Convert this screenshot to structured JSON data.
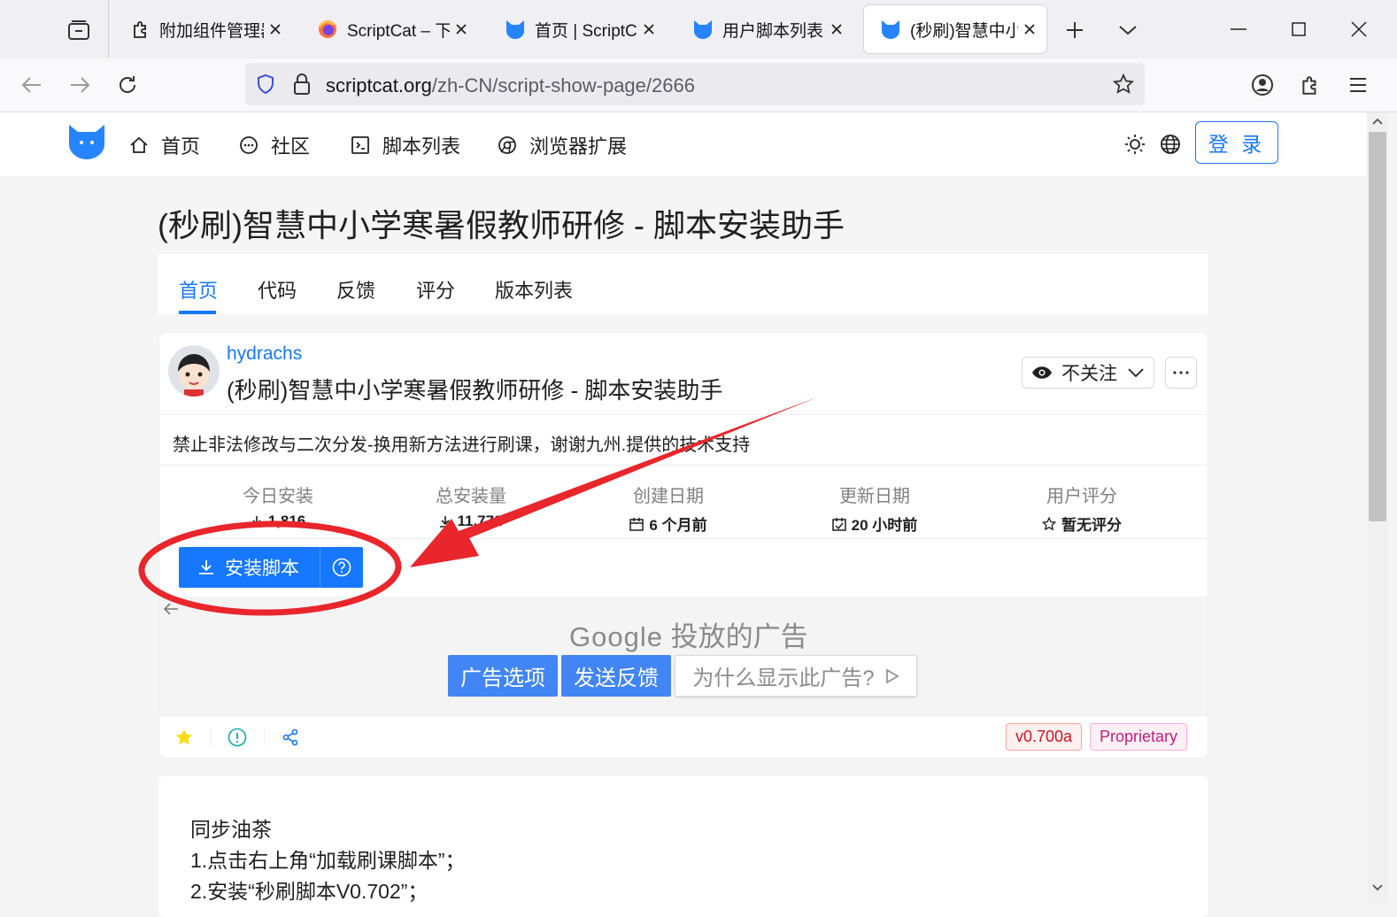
{
  "browser": {
    "tabs": [
      {
        "title": "附加组件管理器",
        "icon": "puzzle-icon"
      },
      {
        "title": "ScriptCat – 下载",
        "icon": "firefox-icon"
      },
      {
        "title": "首页 | ScriptCat",
        "icon": "scriptcat-icon"
      },
      {
        "title": "用户脚本列表 -",
        "icon": "scriptcat-icon"
      },
      {
        "title": "(秒刷)智慧中小学",
        "icon": "scriptcat-icon",
        "active": true
      }
    ],
    "url_host": "scriptcat.org",
    "url_path": "/zh-CN/script-show-page/2666"
  },
  "site": {
    "nav": [
      {
        "label": "首页",
        "icon": "home-icon"
      },
      {
        "label": "社区",
        "icon": "chat-icon"
      },
      {
        "label": "脚本列表",
        "icon": "terminal-icon"
      },
      {
        "label": "浏览器扩展",
        "icon": "chrome-icon"
      }
    ],
    "login_label": "登 录"
  },
  "page": {
    "title": "(秒刷)智慧中小学寒暑假教师研修 - 脚本安装助手",
    "tabs": [
      "首页",
      "代码",
      "反馈",
      "评分",
      "版本列表"
    ],
    "active_tab": 0
  },
  "script": {
    "author": "hydrachs",
    "name": "(秒刷)智慧中小学寒暑假教师研修 - 脚本安装助手",
    "watch_label": "不关注",
    "description": "禁止非法修改与二次分发-换用新方法进行刷课，谢谢九州.提供的技术支持",
    "stats": [
      {
        "label": "今日安装",
        "value": "1,816",
        "icon": "download-icon"
      },
      {
        "label": "总安装量",
        "value": "11,772",
        "icon": "download-icon"
      },
      {
        "label": "创建日期",
        "value": "6 个月前",
        "icon": "calendar-icon"
      },
      {
        "label": "更新日期",
        "value": "20 小时前",
        "icon": "calendar-check-icon"
      },
      {
        "label": "用户评分",
        "value": "暂无评分",
        "icon": "star-outline-icon"
      }
    ],
    "install_label": "安装脚本",
    "version_tag": "v0.700a",
    "license_tag": "Proprietary"
  },
  "ad": {
    "brand": "Google",
    "brand_suffix": "投放的广告",
    "options_label": "广告选项",
    "feedback_label": "发送反馈",
    "why_label": "为什么显示此广告?"
  },
  "content": {
    "lines": [
      "同步油茶",
      "1.点击右上角“加载刷课脚本”；",
      "2.安装“秒刷脚本V0.702”；"
    ]
  },
  "colors": {
    "primary": "#1677ff",
    "annotation": "#e8262b",
    "google_blue": "#4285f4"
  }
}
